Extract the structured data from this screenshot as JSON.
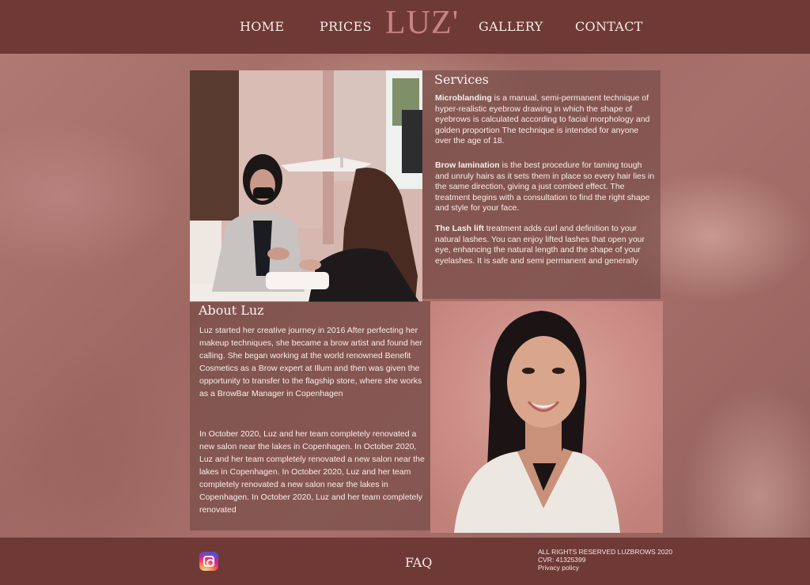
{
  "nav": {
    "home": "HOME",
    "prices": "PRICES",
    "logo": "LUZ'",
    "gallery": "GALLERY",
    "contact": "CONTACT"
  },
  "services": {
    "title": "Services",
    "items": [
      {
        "name": "Microblanding",
        "text": " is a manual, semi-permanent technique of hyper-realistic eyebrow drawing in which the shape of eyebrows is calculated according to facial morphology and golden proportion The technique is intended for anyone over the age of 18."
      },
      {
        "name": "Brow lamination",
        "text": " is the best procedure for taming tough and unruly hairs as it sets them in place so every hair lies in the same direction, giving a just combed effect. The treatment begins with a consultation to find the right shape and style for your face."
      },
      {
        "name": "The Lash lift",
        "text": " treatment adds curl and definition to your natural lashes. You can enjoy lifted lashes that open your eye, enhancing the natural length and the shape of your eyelashes. It is safe and semi permanent and generally"
      }
    ]
  },
  "about": {
    "title": "About Luz",
    "para1": "Luz started her creative journey in 2016 After perfecting her makeup techniques, she became a brow artist and found her calling. She began working at the world renowned Benefit Cosmetics as a Brow expert at Illum and then was given the opportunity to transfer to the flagship store, where she works as a BrowBar Manager in Copenhagen",
    "para2": "In October 2020, Luz and her team completely renovated a new salon near the lakes in Copenhagen. In October 2020, Luz and her team completely renovated a new salon near the lakes in Copenhagen. In October 2020, Luz and her team completely renovated a new salon near the lakes in Copenhagen. In October 2020, Luz and her team completely renovated"
  },
  "footer": {
    "faq": "FAQ",
    "rights": "ALL RIGHTS RESERVED LUZBROWS 2020",
    "cvr": "CVR: 41325399",
    "privacy": "Privacy policy"
  },
  "colors": {
    "header_bg": "#6f3a36",
    "logo": "#c98383",
    "panel_text": "#f7eeea"
  },
  "icons": {
    "social": "instagram-icon"
  }
}
